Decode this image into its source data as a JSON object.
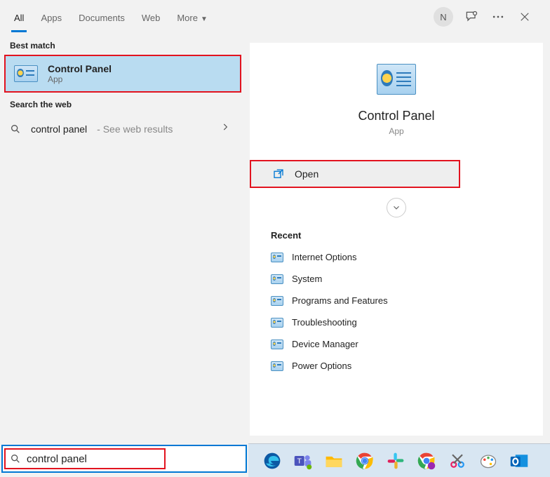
{
  "tabs": {
    "all": "All",
    "apps": "Apps",
    "documents": "Documents",
    "web": "Web",
    "more": "More"
  },
  "avatar_initial": "N",
  "left": {
    "best_match_label": "Best match",
    "result": {
      "title": "Control Panel",
      "subtitle": "App"
    },
    "search_web_label": "Search the web",
    "web": {
      "query": "control panel",
      "suffix": " - See web results"
    }
  },
  "details": {
    "title": "Control Panel",
    "subtitle": "App",
    "open_label": "Open",
    "recent_label": "Recent",
    "recent": [
      "Internet Options",
      "System",
      "Programs and Features",
      "Troubleshooting",
      "Device Manager",
      "Power Options"
    ]
  },
  "search": {
    "value": "control panel"
  },
  "taskbar_icons": [
    "edge",
    "teams",
    "file-explorer",
    "chrome",
    "slack",
    "chrome-profile",
    "snip",
    "paint",
    "outlook"
  ]
}
